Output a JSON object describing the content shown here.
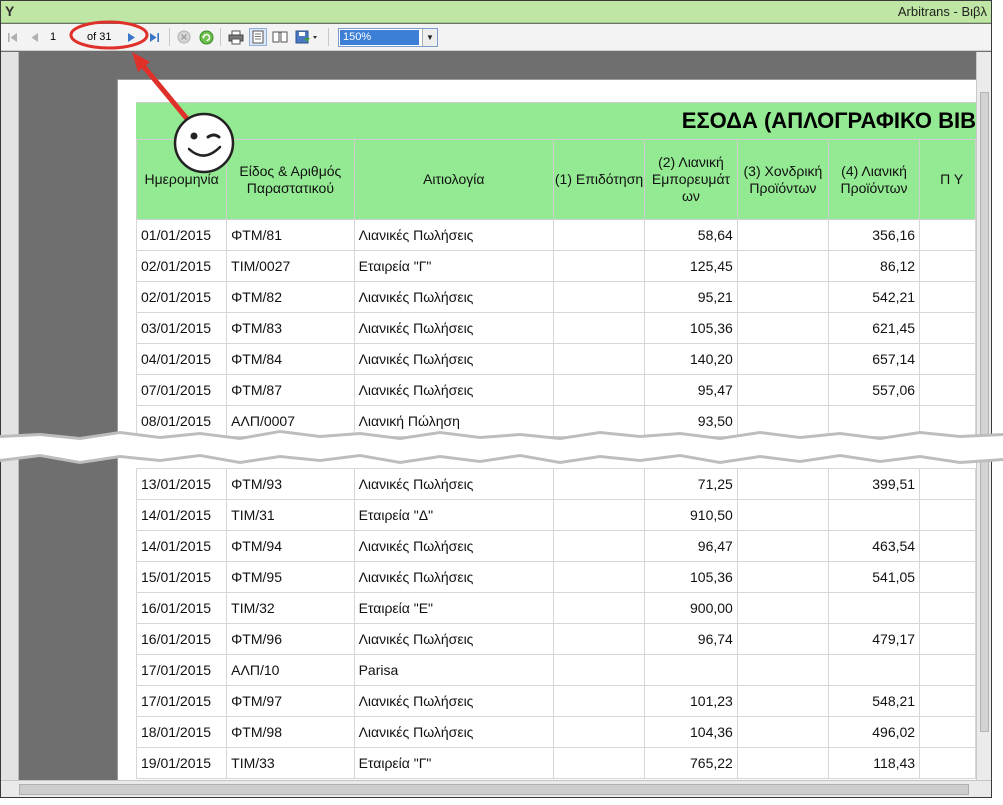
{
  "window": {
    "title": "Arbitrans - Βιβλ",
    "logo_glyph": "Y"
  },
  "toolbar": {
    "first_page_icon": "first-page-icon",
    "prev_page_icon": "previous-page-icon",
    "current_page": "1",
    "page_of_text": "of 31",
    "next_page_icon": "next-page-icon",
    "last_page_icon": "last-page-icon",
    "stop_icon": "stop-icon",
    "refresh_icon": "refresh-icon",
    "print_icon": "print-icon",
    "print_layout_icon": "print-layout-icon",
    "page_setup_icon": "page-setup-icon",
    "export_icon": "export-icon",
    "zoom": "150%"
  },
  "report": {
    "title": "ΕΣΟΔΑ (ΑΠΛΟΓΡΑΦΙΚΟ ΒΙΒ",
    "columns": [
      "Ημερομηνία",
      "Είδος & Αριθμός Παραστατικού",
      "Αιτιολογία",
      "(1) Επιδότηση",
      "(2) Λιανική Εμπορευμάτ ων",
      "(3) Χονδρική Προϊόντων",
      "(4) Λιανική Προϊόντων",
      "Π Υ"
    ],
    "rows_top": [
      [
        "01/01/2015",
        "ΦΤΜ/81",
        "Λιανικές Πωλήσεις",
        "",
        "58,64",
        "",
        "356,16"
      ],
      [
        "02/01/2015",
        "ΤΙΜ/0027",
        "Εταιρεία \"Γ\"",
        "",
        "125,45",
        "",
        "86,12"
      ],
      [
        "02/01/2015",
        "ΦΤΜ/82",
        "Λιανικές Πωλήσεις",
        "",
        "95,21",
        "",
        "542,21"
      ],
      [
        "03/01/2015",
        "ΦΤΜ/83",
        "Λιανικές Πωλήσεις",
        "",
        "105,36",
        "",
        "621,45"
      ],
      [
        "04/01/2015",
        "ΦΤΜ/84",
        "Λιανικές Πωλήσεις",
        "",
        "140,20",
        "",
        "657,14"
      ],
      [
        "07/01/2015",
        "ΦΤΜ/87",
        "Λιανικές Πωλήσεις",
        "",
        "95,47",
        "",
        "557,06"
      ],
      [
        "08/01/2015",
        "ΑΛΠ/0007",
        "Λιανική Πώληση",
        "",
        "93,50",
        "",
        ""
      ]
    ],
    "rows_bottom": [
      [
        "13/01/2015",
        "ΦΤΜ/93",
        "Λιανικές Πωλήσεις",
        "",
        "71,25",
        "",
        "399,51"
      ],
      [
        "14/01/2015",
        "ΤΙΜ/31",
        "Εταιρεία \"Δ\"",
        "",
        "910,50",
        "",
        ""
      ],
      [
        "14/01/2015",
        "ΦΤΜ/94",
        "Λιανικές Πωλήσεις",
        "",
        "96,47",
        "",
        "463,54"
      ],
      [
        "15/01/2015",
        "ΦΤΜ/95",
        "Λιανικές Πωλήσεις",
        "",
        "105,36",
        "",
        "541,05"
      ],
      [
        "16/01/2015",
        "ΤΙΜ/32",
        "Εταιρεία \"Ε\"",
        "",
        "900,00",
        "",
        ""
      ],
      [
        "16/01/2015",
        "ΦΤΜ/96",
        "Λιανικές Πωλήσεις",
        "",
        "96,74",
        "",
        "479,17"
      ],
      [
        "17/01/2015",
        "ΑΛΠ/10",
        "Parisa",
        "",
        "",
        "",
        ""
      ],
      [
        "17/01/2015",
        "ΦΤΜ/97",
        "Λιανικές Πωλήσεις",
        "",
        "101,23",
        "",
        "548,21"
      ],
      [
        "18/01/2015",
        "ΦΤΜ/98",
        "Λιανικές Πωλήσεις",
        "",
        "104,36",
        "",
        "496,02"
      ],
      [
        "19/01/2015",
        "ΤΙΜ/33",
        "Εταιρεία \"Γ\"",
        "",
        "765,22",
        "",
        "118,43"
      ]
    ]
  },
  "annotation": {
    "smiley_icon": "winking-smiley-icon",
    "arrow_color": "#e0302a"
  },
  "colors": {
    "header_green": "#93ea93",
    "title_bar": "#bfe6a4",
    "zoom_highlight": "#3c7fd6"
  }
}
